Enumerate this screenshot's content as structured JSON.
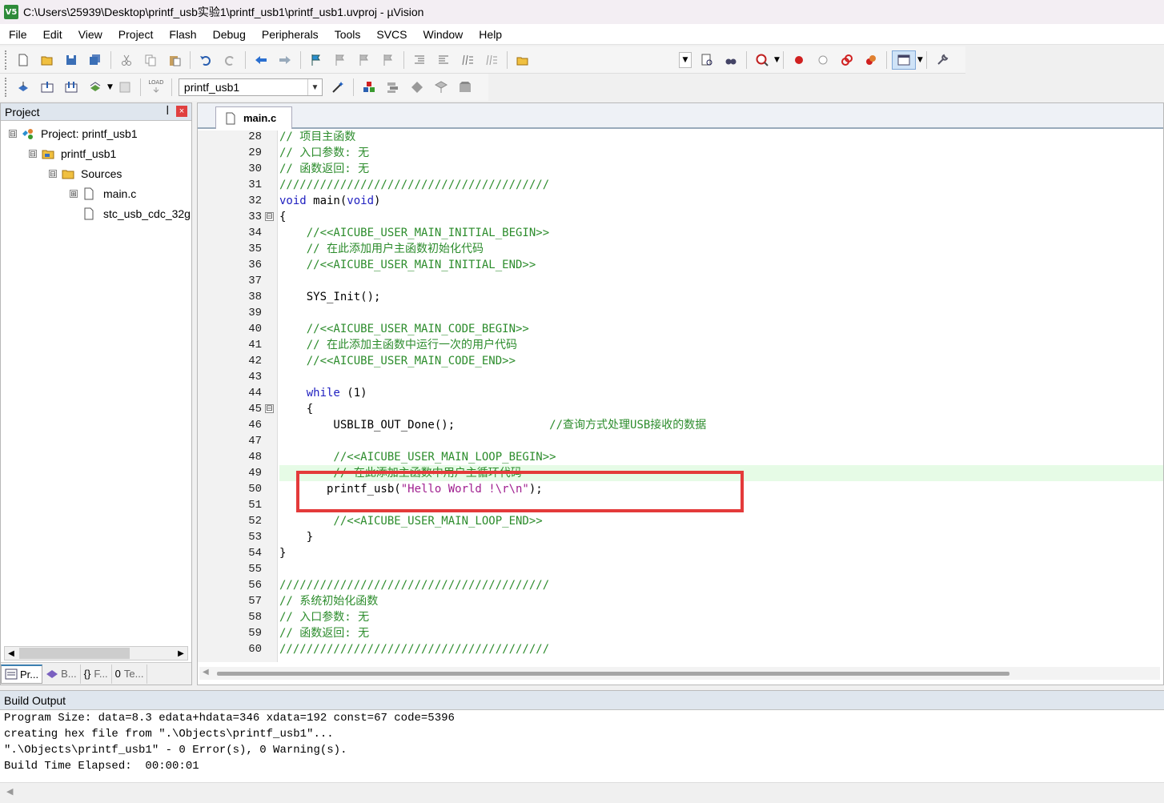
{
  "window": {
    "title": "C:\\Users\\25939\\Desktop\\printf_usb实验1\\printf_usb1\\printf_usb1.uvproj - µVision",
    "app_icon_text": "V5"
  },
  "menu": [
    "File",
    "Edit",
    "View",
    "Project",
    "Flash",
    "Debug",
    "Peripherals",
    "Tools",
    "SVCS",
    "Window",
    "Help"
  ],
  "toolbar2": {
    "target": "printf_usb1",
    "load_label": "LOAD"
  },
  "project_panel": {
    "title": "Project",
    "tree": [
      {
        "label": "Project: printf_usb1",
        "level": 0,
        "expander": "⊟"
      },
      {
        "label": "printf_usb1",
        "level": 1,
        "expander": "⊟"
      },
      {
        "label": "Sources",
        "level": 2,
        "expander": "⊟"
      },
      {
        "label": "main.c",
        "level": 3,
        "expander": "⊞"
      },
      {
        "label": "stc_usb_cdc_32g",
        "level": 3,
        "expander": ""
      }
    ],
    "tabs": [
      "Pr...",
      "B...",
      "F...",
      "Te..."
    ],
    "tab_glyphs": [
      "",
      "",
      "{}",
      "0"
    ]
  },
  "editor": {
    "tab": "main.c",
    "lines": [
      {
        "n": "28",
        "fold": "",
        "segs": [
          {
            "t": "// 项目主函数",
            "c": "cm"
          }
        ]
      },
      {
        "n": "29",
        "fold": "",
        "segs": [
          {
            "t": "// 入口参数: 无",
            "c": "cm"
          }
        ]
      },
      {
        "n": "30",
        "fold": "",
        "segs": [
          {
            "t": "// 函数返回: 无",
            "c": "cm"
          }
        ]
      },
      {
        "n": "31",
        "fold": "",
        "segs": [
          {
            "t": "////////////////////////////////////////",
            "c": "cm"
          }
        ]
      },
      {
        "n": "32",
        "fold": "",
        "segs": [
          {
            "t": "void",
            "c": "kw"
          },
          {
            "t": " main(",
            "c": "tx"
          },
          {
            "t": "void",
            "c": "kw"
          },
          {
            "t": ")",
            "c": "tx"
          }
        ]
      },
      {
        "n": "33",
        "fold": "⊟",
        "segs": [
          {
            "t": "{",
            "c": "tx"
          }
        ]
      },
      {
        "n": "34",
        "fold": "",
        "segs": [
          {
            "t": "    //<<AICUBE_USER_MAIN_INITIAL_BEGIN>>",
            "c": "cm"
          }
        ]
      },
      {
        "n": "35",
        "fold": "",
        "segs": [
          {
            "t": "    // 在此添加用户主函数初始化代码",
            "c": "cm"
          }
        ]
      },
      {
        "n": "36",
        "fold": "",
        "segs": [
          {
            "t": "    //<<AICUBE_USER_MAIN_INITIAL_END>>",
            "c": "cm"
          }
        ]
      },
      {
        "n": "37",
        "fold": "",
        "segs": []
      },
      {
        "n": "38",
        "fold": "",
        "segs": [
          {
            "t": "    SYS_Init();",
            "c": "tx"
          }
        ]
      },
      {
        "n": "39",
        "fold": "",
        "segs": []
      },
      {
        "n": "40",
        "fold": "",
        "segs": [
          {
            "t": "    //<<AICUBE_USER_MAIN_CODE_BEGIN>>",
            "c": "cm"
          }
        ]
      },
      {
        "n": "41",
        "fold": "",
        "segs": [
          {
            "t": "    // 在此添加主函数中运行一次的用户代码",
            "c": "cm"
          }
        ]
      },
      {
        "n": "42",
        "fold": "",
        "segs": [
          {
            "t": "    //<<AICUBE_USER_MAIN_CODE_END>>",
            "c": "cm"
          }
        ]
      },
      {
        "n": "43",
        "fold": "",
        "segs": []
      },
      {
        "n": "44",
        "fold": "",
        "segs": [
          {
            "t": "    ",
            "c": "tx"
          },
          {
            "t": "while",
            "c": "kw"
          },
          {
            "t": " (1)",
            "c": "tx"
          }
        ]
      },
      {
        "n": "45",
        "fold": "⊟",
        "segs": [
          {
            "t": "    {",
            "c": "tx"
          }
        ]
      },
      {
        "n": "46",
        "fold": "",
        "segs": [
          {
            "t": "        USBLIB_OUT_Done();              ",
            "c": "tx"
          },
          {
            "t": "//查询方式处理USB接收的数据",
            "c": "cm"
          }
        ]
      },
      {
        "n": "47",
        "fold": "",
        "segs": []
      },
      {
        "n": "48",
        "fold": "",
        "segs": [
          {
            "t": "        //<<AICUBE_USER_MAIN_LOOP_BEGIN>>",
            "c": "cm"
          }
        ]
      },
      {
        "n": "49",
        "fold": "",
        "hl": true,
        "segs": [
          {
            "t": "        // 在此添加主函数中用户主循环代码",
            "c": "cm"
          }
        ]
      },
      {
        "n": "50",
        "fold": "",
        "segs": [
          {
            "t": "       printf_usb(",
            "c": "tx"
          },
          {
            "t": "\"Hello World !\\r\\n\"",
            "c": "st"
          },
          {
            "t": ");",
            "c": "tx"
          }
        ]
      },
      {
        "n": "51",
        "fold": "",
        "segs": []
      },
      {
        "n": "52",
        "fold": "",
        "segs": [
          {
            "t": "        //<<AICUBE_USER_MAIN_LOOP_END>>",
            "c": "cm"
          }
        ]
      },
      {
        "n": "53",
        "fold": "",
        "segs": [
          {
            "t": "    }",
            "c": "tx"
          }
        ]
      },
      {
        "n": "54",
        "fold": "",
        "segs": [
          {
            "t": "}",
            "c": "tx"
          }
        ]
      },
      {
        "n": "55",
        "fold": "",
        "segs": []
      },
      {
        "n": "56",
        "fold": "",
        "segs": [
          {
            "t": "////////////////////////////////////////",
            "c": "cm"
          }
        ]
      },
      {
        "n": "57",
        "fold": "",
        "segs": [
          {
            "t": "// 系统初始化函数",
            "c": "cm"
          }
        ]
      },
      {
        "n": "58",
        "fold": "",
        "segs": [
          {
            "t": "// 入口参数: 无",
            "c": "cm"
          }
        ]
      },
      {
        "n": "59",
        "fold": "",
        "segs": [
          {
            "t": "// 函数返回: 无",
            "c": "cm"
          }
        ]
      },
      {
        "n": "60",
        "fold": "",
        "segs": [
          {
            "t": "////////////////////////////////////////",
            "c": "cm"
          }
        ]
      }
    ]
  },
  "build_output": {
    "title": "Build Output",
    "lines": [
      "Program Size: data=8.3 edata+hdata=346 xdata=192 const=67 code=5396",
      "creating hex file from \".\\Objects\\printf_usb1\"...",
      "\".\\Objects\\printf_usb1\" - 0 Error(s), 0 Warning(s).",
      "Build Time Elapsed:  00:00:01"
    ]
  },
  "colors": {
    "comment": "#2c8c2c",
    "keyword": "#2020c0",
    "string": "#a02090",
    "highlight_box": "#e43a3a"
  }
}
